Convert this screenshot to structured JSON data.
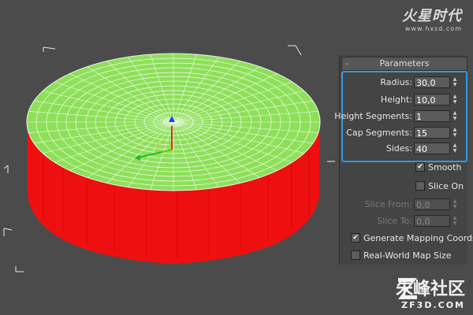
{
  "watermark_top": {
    "logo": "火星时代",
    "url": "www.hxsd.com"
  },
  "watermark_bottom": {
    "name": "朱峰社区",
    "site": "ZF3D.COM"
  },
  "panel": {
    "rollout_title": "Parameters",
    "collapse_symbol": "-",
    "fields": [
      {
        "label": "Radius:",
        "value": "30,0"
      },
      {
        "label": "Height:",
        "value": "10,0"
      },
      {
        "label": "Height Segments:",
        "value": "1"
      },
      {
        "label": "Cap Segments:",
        "value": "15"
      },
      {
        "label": "Sides:",
        "value": "40"
      }
    ],
    "smooth": {
      "label": "Smooth",
      "checked": true
    },
    "slice_on": {
      "label": "Slice On",
      "checked": false
    },
    "slice_from": {
      "label": "Slice From:",
      "value": "0,0"
    },
    "slice_to": {
      "label": "Slice To:",
      "value": "0,0"
    },
    "gen_mapping": {
      "label": "Generate Mapping Coords.",
      "checked": true
    },
    "real_world": {
      "label": "Real-World Map Size",
      "checked": false
    }
  },
  "colors": {
    "cap": "#8ee05a",
    "side": "#ee1010",
    "highlight": "#2e9be6",
    "viewport_bg": "#4b4b4b"
  }
}
